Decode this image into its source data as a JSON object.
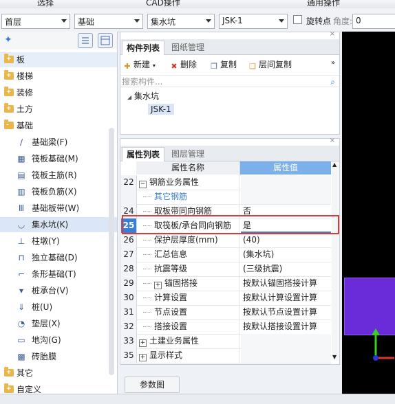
{
  "top_menu": {
    "item1": "选择",
    "item2": "CAD操作",
    "item3": "通用操作"
  },
  "toolbar": {
    "floor": "首层",
    "category": "基础",
    "type": "集水坑",
    "component": "JSK-1",
    "rotate_label": "旋转点",
    "angle_label": "角度:",
    "angle_value": "0"
  },
  "tree": {
    "items": [
      {
        "label": "板",
        "kind": "folder",
        "sign": "+",
        "selected": true
      },
      {
        "label": "楼梯",
        "kind": "folder",
        "sign": "+"
      },
      {
        "label": "装修",
        "kind": "folder",
        "sign": "+"
      },
      {
        "label": "土方",
        "kind": "folder",
        "sign": "+"
      },
      {
        "label": "基础",
        "kind": "folder",
        "sign": "-"
      },
      {
        "label": "基础梁(F)",
        "kind": "child",
        "icon": "beam"
      },
      {
        "label": "筏板基础(M)",
        "kind": "child",
        "icon": "raft"
      },
      {
        "label": "筏板主筋(R)",
        "kind": "child",
        "icon": "rebar"
      },
      {
        "label": "筏板负筋(X)",
        "kind": "child",
        "icon": "negrebar"
      },
      {
        "label": "基础板带(W)",
        "kind": "child",
        "icon": "strip"
      },
      {
        "label": "集水坑(K)",
        "kind": "child",
        "icon": "sump",
        "selected": true
      },
      {
        "label": "柱墩(Y)",
        "kind": "child",
        "icon": "pier"
      },
      {
        "label": "独立基础(D)",
        "kind": "child",
        "icon": "isolated"
      },
      {
        "label": "条形基础(T)",
        "kind": "child",
        "icon": "strip-footing"
      },
      {
        "label": "桩承台(V)",
        "kind": "child",
        "icon": "pilecap"
      },
      {
        "label": "桩(U)",
        "kind": "child",
        "icon": "pile"
      },
      {
        "label": "垫层(X)",
        "kind": "child",
        "icon": "cushion"
      },
      {
        "label": "地沟(G)",
        "kind": "child",
        "icon": "trench"
      },
      {
        "label": "砖胎膜",
        "kind": "child",
        "icon": "brick"
      },
      {
        "label": "其它",
        "kind": "folder",
        "sign": "+"
      },
      {
        "label": "自定义",
        "kind": "folder",
        "sign": "+"
      }
    ]
  },
  "component_panel": {
    "tab_active": "构件列表",
    "tab_inactive": "图纸管理",
    "new_label": "新建",
    "delete_label": "删除",
    "copy_label": "复制",
    "floor_copy_label": "层间复制",
    "search_placeholder": "搜索构件...",
    "tree_root": "集水坑",
    "tree_child": "JSK-1"
  },
  "property_panel": {
    "tab_active": "属性列表",
    "tab_inactive": "图层管理",
    "col_name": "属性名称",
    "col_value": "属性值",
    "rows": [
      {
        "num": "22",
        "name": "钢筋业务属性",
        "value": "",
        "indent": 0,
        "box": "-"
      },
      {
        "num": "",
        "name": "其它钢筋",
        "value": "",
        "indent": 1,
        "link": true
      },
      {
        "num": "24",
        "name": "取板带同向钢筋",
        "value": "否",
        "indent": 1
      },
      {
        "num": "25",
        "name": "取筏板/承台同向钢筋",
        "value": "是",
        "indent": 1,
        "active": true
      },
      {
        "num": "26",
        "name": "保护层厚度(mm)",
        "value": "(40)",
        "indent": 1
      },
      {
        "num": "27",
        "name": "汇总信息",
        "value": "(集水坑)",
        "indent": 1
      },
      {
        "num": "28",
        "name": "抗震等级",
        "value": "(三级抗震)",
        "indent": 1
      },
      {
        "num": "29",
        "name": "锚固搭接",
        "value": "按默认锚固搭接计算",
        "indent": 1,
        "box": "+"
      },
      {
        "num": "30",
        "name": "计算设置",
        "value": "按默认计算设置计算",
        "indent": 1
      },
      {
        "num": "31",
        "name": "节点设置",
        "value": "按默认节点设置计算",
        "indent": 1
      },
      {
        "num": "32",
        "name": "搭接设置",
        "value": "按默认搭接设置计算",
        "indent": 1
      },
      {
        "num": "33",
        "name": "土建业务属性",
        "value": "",
        "indent": 0,
        "box": "+"
      },
      {
        "num": "35",
        "name": "显示样式",
        "value": "",
        "indent": 0,
        "box": "+"
      }
    ],
    "param_button": "参数图"
  },
  "colors": {
    "accent": "#3b7fd4",
    "highlight": "#d93a3a",
    "canvas_shape": "#6a2bd8",
    "header_value": "#7cb0ea"
  }
}
